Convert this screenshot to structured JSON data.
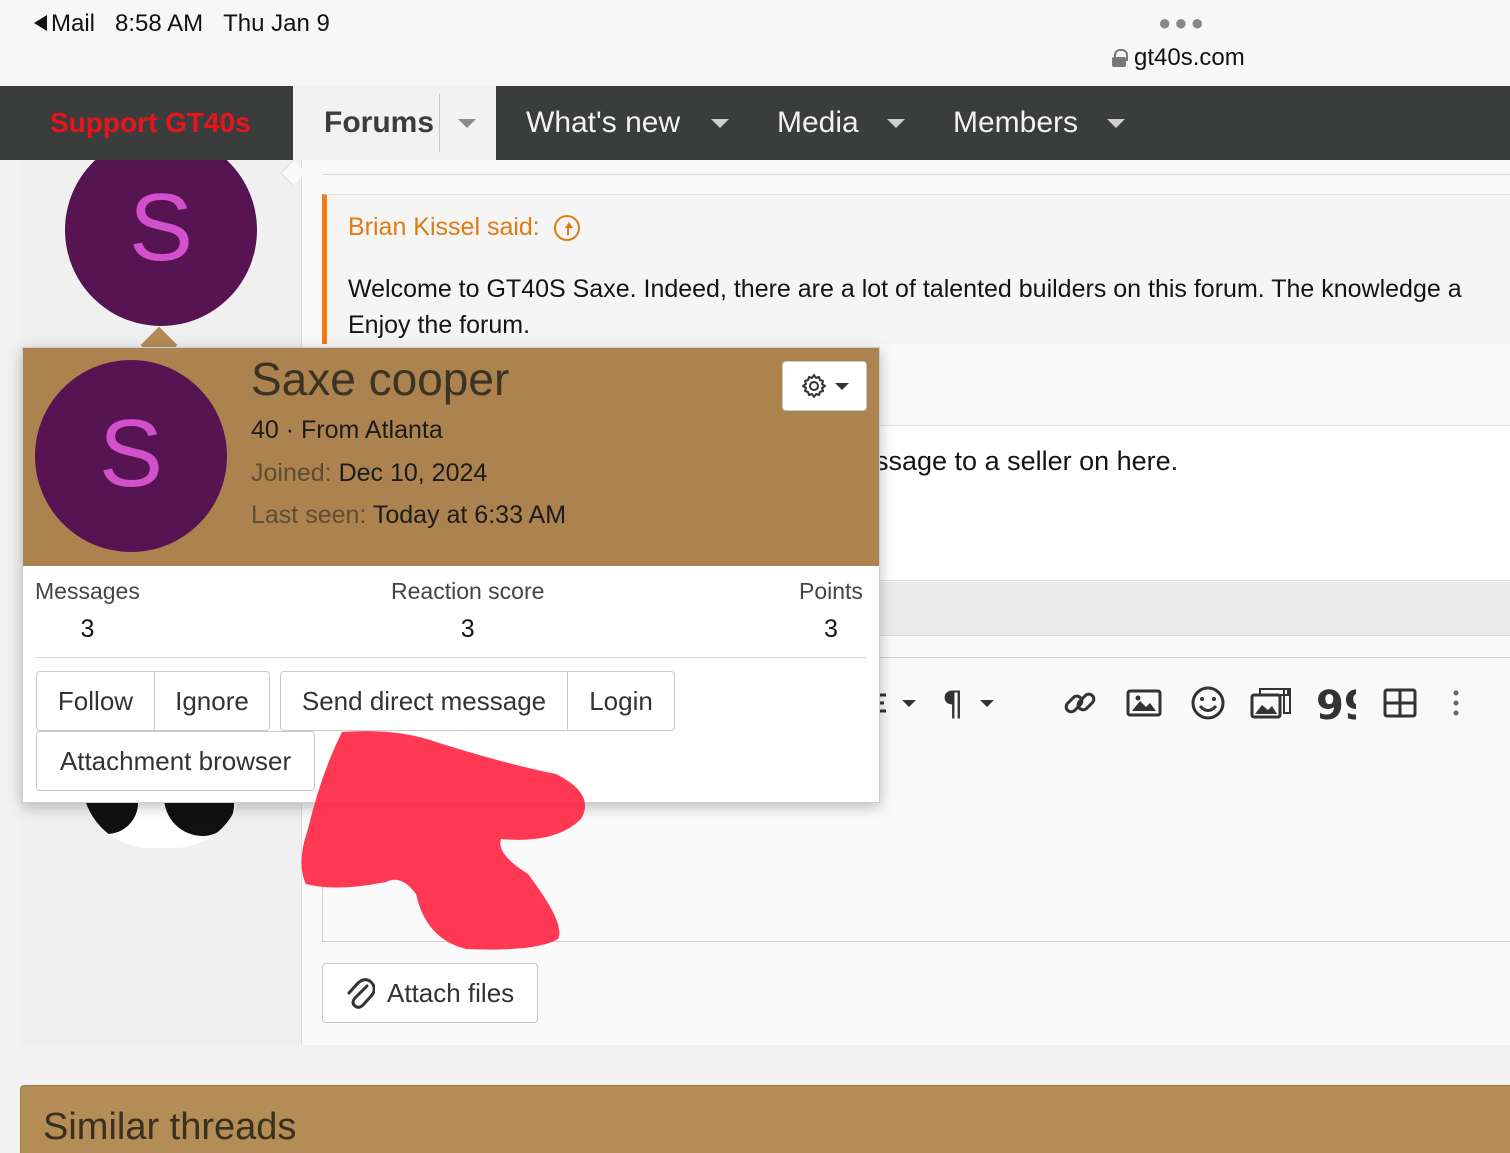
{
  "status_bar": {
    "back_app": "Mail",
    "time": "8:58 AM",
    "date": "Thu Jan 9",
    "url": "gt40s.com"
  },
  "nav": {
    "support": "Support GT40s",
    "forums": "Forums",
    "whats_new": "What's new",
    "media": "Media",
    "members": "Members"
  },
  "quote": {
    "author": "Brian Kissel said:",
    "line1": "Welcome to GT40S Saxe. Indeed, there are a lot of talented builders on this forum. The knowledge a",
    "line2": "Enjoy the forum."
  },
  "reply": {
    "partial_text": "ssage to a seller on here."
  },
  "avatar_letter": "S",
  "popup": {
    "name": "Saxe cooper",
    "age_location": "40 · From Atlanta",
    "joined_label": "Joined:",
    "joined_value": "Dec 10, 2024",
    "last_seen_label": "Last seen:",
    "last_seen_value": "Today at 6:33 AM",
    "stats": [
      {
        "label": "Messages",
        "value": "3"
      },
      {
        "label": "Reaction score",
        "value": "3"
      },
      {
        "label": "Points",
        "value": "3"
      }
    ],
    "buttons": {
      "follow": "Follow",
      "ignore": "Ignore",
      "send_dm": "Send direct message",
      "login": "Login",
      "attachment_browser": "Attachment browser"
    }
  },
  "editor": {
    "attach_files": "Attach files"
  },
  "similar_threads": {
    "title": "Similar threads"
  },
  "colors": {
    "brand_brown": "#ac834e",
    "support_red": "#e8141c",
    "quote_orange": "#f17b14",
    "avatar_purple": "#561552"
  }
}
